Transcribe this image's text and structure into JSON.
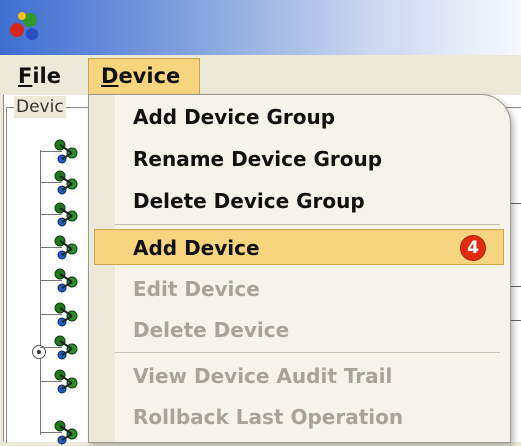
{
  "app": {
    "icon": "molecule-icon"
  },
  "menubar": {
    "file": {
      "label_underlined": "F",
      "label_rest": "ile"
    },
    "device": {
      "label_underlined": "D",
      "label_rest": "evice"
    }
  },
  "panel": {
    "title": "Devic"
  },
  "dropdown": {
    "items": [
      {
        "label": "Add Device Group",
        "enabled": true
      },
      {
        "label": "Rename Device Group",
        "enabled": true
      },
      {
        "label": "Delete Device Group",
        "enabled": true
      },
      {
        "label": "Add Device",
        "enabled": true,
        "selected": true
      },
      {
        "label": "Edit Device",
        "enabled": false
      },
      {
        "label": "Delete Device",
        "enabled": false
      },
      {
        "label": "View Device Audit Trail",
        "enabled": false
      },
      {
        "label": "Rollback Last Operation",
        "enabled": false
      }
    ],
    "step_badge": "4"
  },
  "colors": {
    "highlight": "#f7d57f",
    "badge": "#e32b10",
    "disabled_text": "#a8a49a"
  }
}
